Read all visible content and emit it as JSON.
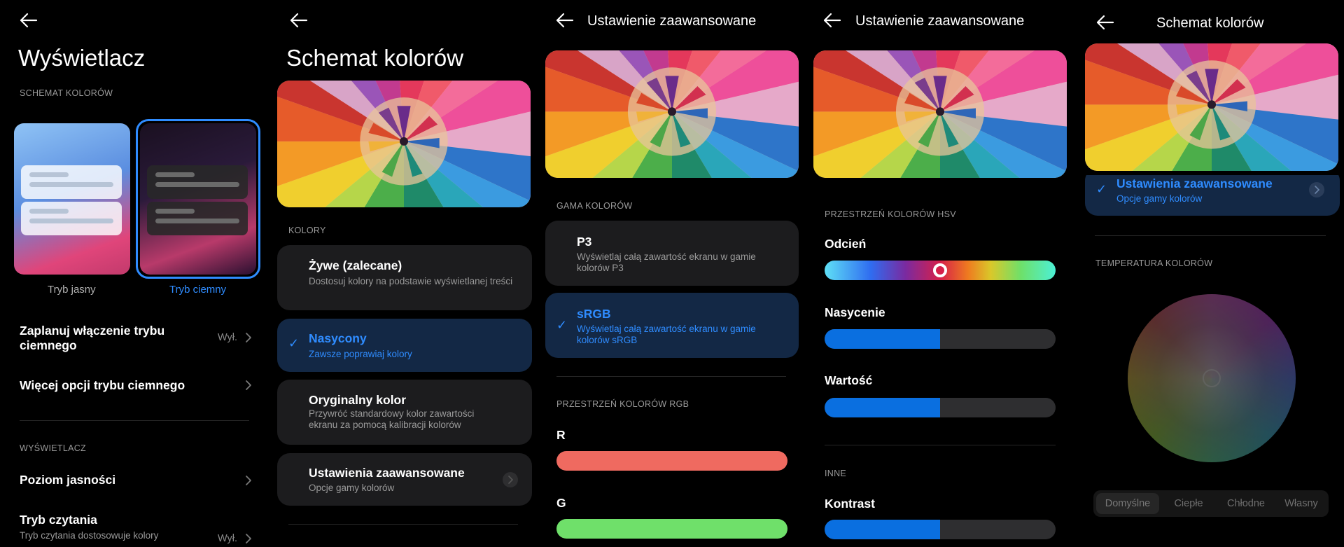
{
  "panel1": {
    "title": "Wyświetlacz",
    "section_scheme": "SCHEMAT KOLORÓW",
    "light_label": "Tryb jasny",
    "dark_label": "Tryb ciemny",
    "schedule_title": "Zaplanuj włączenie trybu ciemnego",
    "schedule_value": "Wył.",
    "more_dark_title": "Więcej opcji trybu ciemnego",
    "section_display": "WYŚWIETLACZ",
    "brightness_title": "Poziom jasności",
    "reading_title": "Tryb czytania",
    "reading_sub": "Tryb czytania dostosowuje kolory",
    "reading_value": "Wył."
  },
  "panel2": {
    "title": "Schemat kolorów",
    "section_colors": "KOLORY",
    "vivid_title": "Żywe (zalecane)",
    "vivid_sub": "Dostosuj kolory na podstawie wyświetlanej treści",
    "saturated_title": "Nasycony",
    "saturated_sub": "Zawsze poprawiaj kolory",
    "original_title": "Oryginalny kolor",
    "original_sub": "Przywróć standardowy kolor zawartości ekranu za pomocą kalibracji kolorów",
    "advanced_title": "Ustawienia zaawansowane",
    "advanced_sub": "Opcje gamy kolorów"
  },
  "panel3": {
    "title": "Ustawienie zaawansowane",
    "section_gamut": "GAMA KOLORÓW",
    "p3_title": "P3",
    "p3_sub": "Wyświetlaj całą zawartość ekranu w gamie kolorów P3",
    "srgb_title": "sRGB",
    "srgb_sub": "Wyświetlaj całą zawartość ekranu w gamie kolorów sRGB",
    "section_rgb": "PRZESTRZEŃ KOLORÓW RGB",
    "r_label": "R",
    "g_label": "G"
  },
  "panel4": {
    "title": "Ustawienie zaawansowane",
    "section_hsv": "PRZESTRZEŃ KOLORÓW HSV",
    "hue_label": "Odcień",
    "saturation_label": "Nasycenie",
    "saturation_level": 0.5,
    "value_label": "Wartość",
    "value_level": 0.5,
    "section_other": "INNE",
    "contrast_label": "Kontrast",
    "contrast_level": 0.5
  },
  "panel5": {
    "title": "Schemat kolorów",
    "advanced_title": "Ustawienia zaawansowane",
    "advanced_sub": "Opcje gamy kolorów",
    "section_temp": "TEMPERATURA KOLORÓW",
    "seg_default": "Domyślne",
    "seg_warm": "Ciepłe",
    "seg_cool": "Chłodne",
    "seg_custom": "Własny"
  },
  "colors": {
    "accent": "#2f8cff",
    "card": "#1c1c1e",
    "selected_card": "#132845",
    "slider_fill": "#0a6fe0",
    "r_bar": "#ef6a60",
    "g_bar": "#6fe06a"
  }
}
